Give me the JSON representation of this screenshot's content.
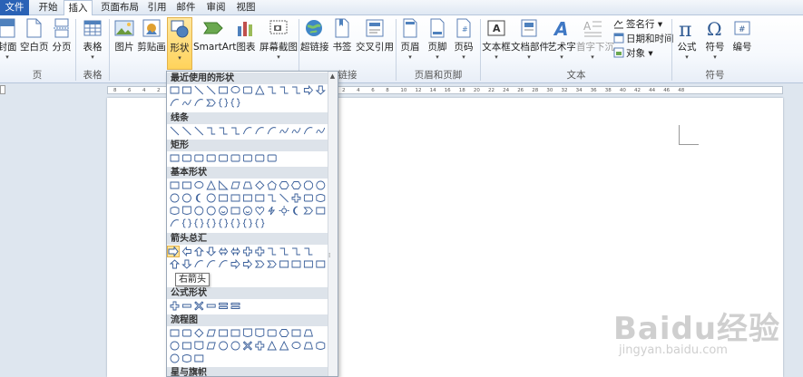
{
  "tabs": [
    {
      "label": "文件",
      "state": "file"
    },
    {
      "label": "开始",
      "state": ""
    },
    {
      "label": "插入",
      "state": "active"
    },
    {
      "label": "页面布局",
      "state": ""
    },
    {
      "label": "引用",
      "state": ""
    },
    {
      "label": "邮件",
      "state": ""
    },
    {
      "label": "审阅",
      "state": ""
    },
    {
      "label": "视图",
      "state": ""
    }
  ],
  "ribbon": {
    "buttons": [
      {
        "label": "封面",
        "icon": "cover-page-icon",
        "has_arrow": true
      },
      {
        "label": "空白页",
        "icon": "blank-page-icon",
        "has_arrow": false
      },
      {
        "label": "分页",
        "icon": "page-break-icon",
        "has_arrow": false
      },
      {
        "label": "表格",
        "icon": "table-icon",
        "has_arrow": true
      },
      {
        "label": "图片",
        "icon": "picture-icon",
        "has_arrow": false
      },
      {
        "label": "剪贴画",
        "icon": "clip-art-icon",
        "has_arrow": false
      },
      {
        "label": "形状",
        "icon": "shapes-icon",
        "has_arrow": true
      },
      {
        "label": "SmartArt",
        "icon": "smartart-icon",
        "has_arrow": false
      },
      {
        "label": "图表",
        "icon": "chart-icon",
        "has_arrow": false
      },
      {
        "label": "屏幕截图",
        "icon": "screenshot-icon",
        "has_arrow": true
      },
      {
        "label": "超链接",
        "icon": "hyperlink-icon",
        "has_arrow": false
      },
      {
        "label": "书签",
        "icon": "bookmark-icon",
        "has_arrow": false
      },
      {
        "label": "交叉引用",
        "icon": "cross-reference-icon",
        "has_arrow": false
      },
      {
        "label": "页眉",
        "icon": "header-icon",
        "has_arrow": true
      },
      {
        "label": "页脚",
        "icon": "footer-icon",
        "has_arrow": true
      },
      {
        "label": "页码",
        "icon": "page-number-icon",
        "has_arrow": true
      },
      {
        "label": "文本框",
        "icon": "text-box-icon",
        "has_arrow": true
      },
      {
        "label": "文档部件",
        "icon": "quick-parts-icon",
        "has_arrow": true
      },
      {
        "label": "艺术字",
        "icon": "wordart-icon",
        "has_arrow": true
      },
      {
        "label": "首字下沉",
        "icon": "drop-cap-icon",
        "has_arrow": true
      },
      {
        "label": "公式",
        "icon": "equation-icon",
        "has_arrow": true
      },
      {
        "label": "符号",
        "icon": "symbol-icon",
        "has_arrow": true
      },
      {
        "label": "编号",
        "icon": "number-icon",
        "has_arrow": false
      }
    ],
    "small_buttons": [
      {
        "label": "签名行",
        "icon": "signature-line-icon",
        "suffix": "▾"
      },
      {
        "label": "日期和时间",
        "icon": "date-time-icon",
        "suffix": ""
      },
      {
        "label": "对象",
        "icon": "object-icon",
        "suffix": "▾"
      }
    ],
    "groups": [
      "页",
      "表格",
      "链接",
      "页眉和页脚",
      "文本",
      "符号"
    ]
  },
  "ruler": {
    "left_ticks": [
      "8",
      "6",
      "4",
      "2"
    ],
    "right_ticks": [
      "2",
      "4",
      "6",
      "8",
      "10",
      "12",
      "14",
      "16",
      "18",
      "20",
      "22",
      "24",
      "26",
      "28",
      "30",
      "32",
      "34",
      "36",
      "38",
      "40",
      "42",
      "44",
      "46",
      "48"
    ]
  },
  "shapes_menu": {
    "sections": [
      "最近使用的形状",
      "线条",
      "矩形",
      "基本形状",
      "箭头总汇",
      "公式形状",
      "流程图",
      "星与旗帜"
    ],
    "tooltip": "右箭头",
    "scroll_up": "▲",
    "grip": "⁞"
  },
  "watermark": {
    "brand": "Baidu经验",
    "url": "jingyan.baidu.com"
  },
  "colors": {
    "accent": "#2a62b6",
    "selected": "#ffd35b",
    "shape_stroke": "#3a5f9a"
  }
}
